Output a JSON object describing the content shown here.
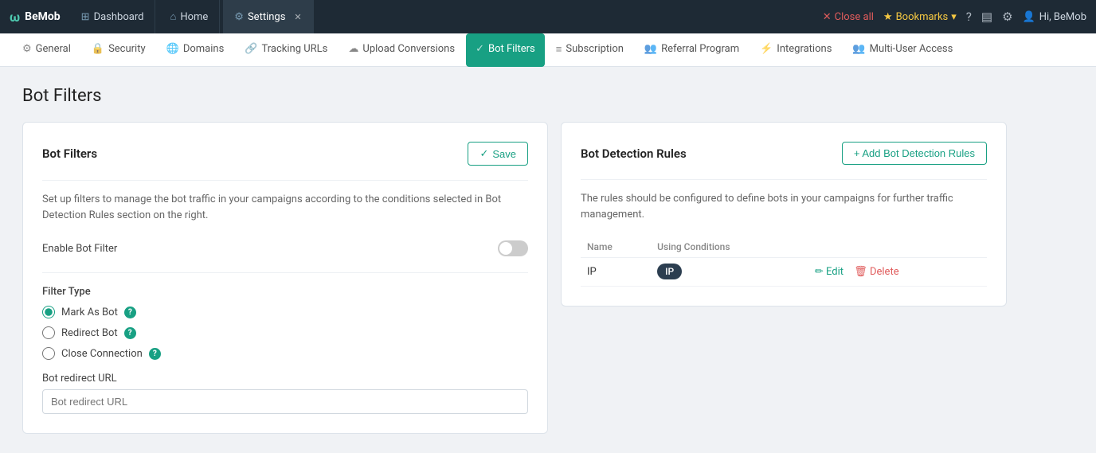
{
  "topbar": {
    "brand": "BeMob",
    "brand_icon": "ω",
    "tabs": [
      {
        "id": "dashboard",
        "icon": "⊞",
        "label": "Dashboard",
        "active": false,
        "closable": false
      },
      {
        "id": "home",
        "icon": "⌂",
        "label": "Home",
        "active": false,
        "closable": false
      },
      {
        "id": "settings",
        "icon": "⚙",
        "label": "Settings",
        "active": true,
        "closable": true
      }
    ],
    "close_all": "Close all",
    "bookmarks": "Bookmarks",
    "hi_user": "Hi, BeMob"
  },
  "secnav": {
    "items": [
      {
        "id": "general",
        "icon": "⚙",
        "label": "General",
        "active": false
      },
      {
        "id": "security",
        "icon": "🔒",
        "label": "Security",
        "active": false
      },
      {
        "id": "domains",
        "icon": "🌐",
        "label": "Domains",
        "active": false
      },
      {
        "id": "tracking-urls",
        "icon": "🔗",
        "label": "Tracking URLs",
        "active": false
      },
      {
        "id": "upload-conversions",
        "icon": "☁",
        "label": "Upload Conversions",
        "active": false
      },
      {
        "id": "bot-filters",
        "icon": "✓",
        "label": "Bot Filters",
        "active": true
      },
      {
        "id": "subscription",
        "icon": "≡",
        "label": "Subscription",
        "active": false
      },
      {
        "id": "referral-program",
        "icon": "👥",
        "label": "Referral Program",
        "active": false
      },
      {
        "id": "integrations",
        "icon": "⚡",
        "label": "Integrations",
        "active": false
      },
      {
        "id": "multi-user-access",
        "icon": "👥",
        "label": "Multi-User Access",
        "active": false
      }
    ]
  },
  "page": {
    "title": "Bot Filters"
  },
  "left_card": {
    "title": "Bot Filters",
    "save_btn": "Save",
    "check_icon": "✓",
    "description": "Set up filters to manage the bot traffic in your campaigns according to the conditions selected in Bot Detection Rules section on the right.",
    "toggle_label": "Enable Bot Filter",
    "toggle_on": false,
    "filter_type_label": "Filter Type",
    "filter_options": [
      {
        "id": "mark-as-bot",
        "label": "Mark As Bot",
        "checked": true
      },
      {
        "id": "redirect-bot",
        "label": "Redirect Bot",
        "checked": false
      },
      {
        "id": "close-connection",
        "label": "Close Connection",
        "checked": false
      }
    ],
    "url_label": "Bot redirect URL",
    "url_placeholder": "Bot redirect URL"
  },
  "right_card": {
    "title": "Bot Detection Rules",
    "add_btn": "+ Add Bot Detection Rules",
    "description": "The rules should be configured to define bots in your campaigns for further traffic management.",
    "table_headers": [
      "Name",
      "Using Conditions"
    ],
    "rules": [
      {
        "name": "IP",
        "condition": "IP",
        "edit_label": "Edit",
        "delete_label": "Delete"
      }
    ]
  }
}
